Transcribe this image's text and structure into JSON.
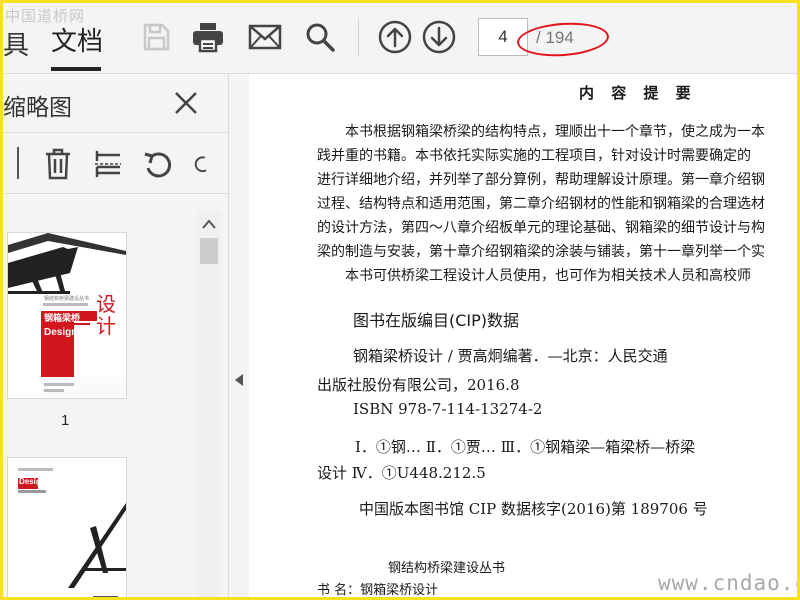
{
  "watermarks": {
    "top": "中国道桥网",
    "bottom": "www.cndao.com"
  },
  "toolbar": {
    "tab_partial": "具",
    "tab_document": "文档",
    "page_current": "4",
    "page_total": "/ 194"
  },
  "sidebar": {
    "title": "缩略图",
    "thumbnails": [
      {
        "label": "1"
      }
    ],
    "thumb1_series": "钢结构桥梁建设丛书",
    "thumb1_title_cn": "钢箱梁桥",
    "thumb1_title_en": "Design",
    "thumb1_big_cn": "设计",
    "thumb2_title_en": "Design"
  },
  "document": {
    "title": "内 容 提 要",
    "paragraph_lines": [
      "本书根据钢箱梁桥梁的结构特点，理顺出十一个章节，使之成为一本",
      "践并重的书籍。本书依托实际实施的工程项目，针对设计时需要确定的",
      "进行详细地介绍，并列举了部分算例，帮助理解设计原理。第一章介绍钢",
      "过程、结构特点和适用范围，第二章介绍钢材的性能和钢箱梁的合理选材",
      "的设计方法，第四～八章介绍板单元的理论基础、钢箱梁的细节设计与构",
      "梁的制造与安装，第十章介绍钢箱梁的涂装与铺装，第十一章列举一个实",
      "本书可供桥梁工程设计人员使用，也可作为相关技术人员和高校师"
    ],
    "cip_heading": "图书在版编目(CIP)数据",
    "cip_lines": [
      "钢箱梁桥设计 / 贾高炯编著．—北京：人民交通",
      "出版社股份有限公司，2016.8",
      "ISBN  978-7-114-13274-2",
      "Ⅰ．①钢…  Ⅱ．①贾…  Ⅲ．①钢箱梁—箱梁桥—桥梁",
      "设计  Ⅳ．①U448.212.5",
      "中国版本图书馆 CIP 数据核字(2016)第 189706 号"
    ],
    "series": "钢结构桥梁建设丛书",
    "book_name": "书      名：钢箱梁桥设计"
  }
}
